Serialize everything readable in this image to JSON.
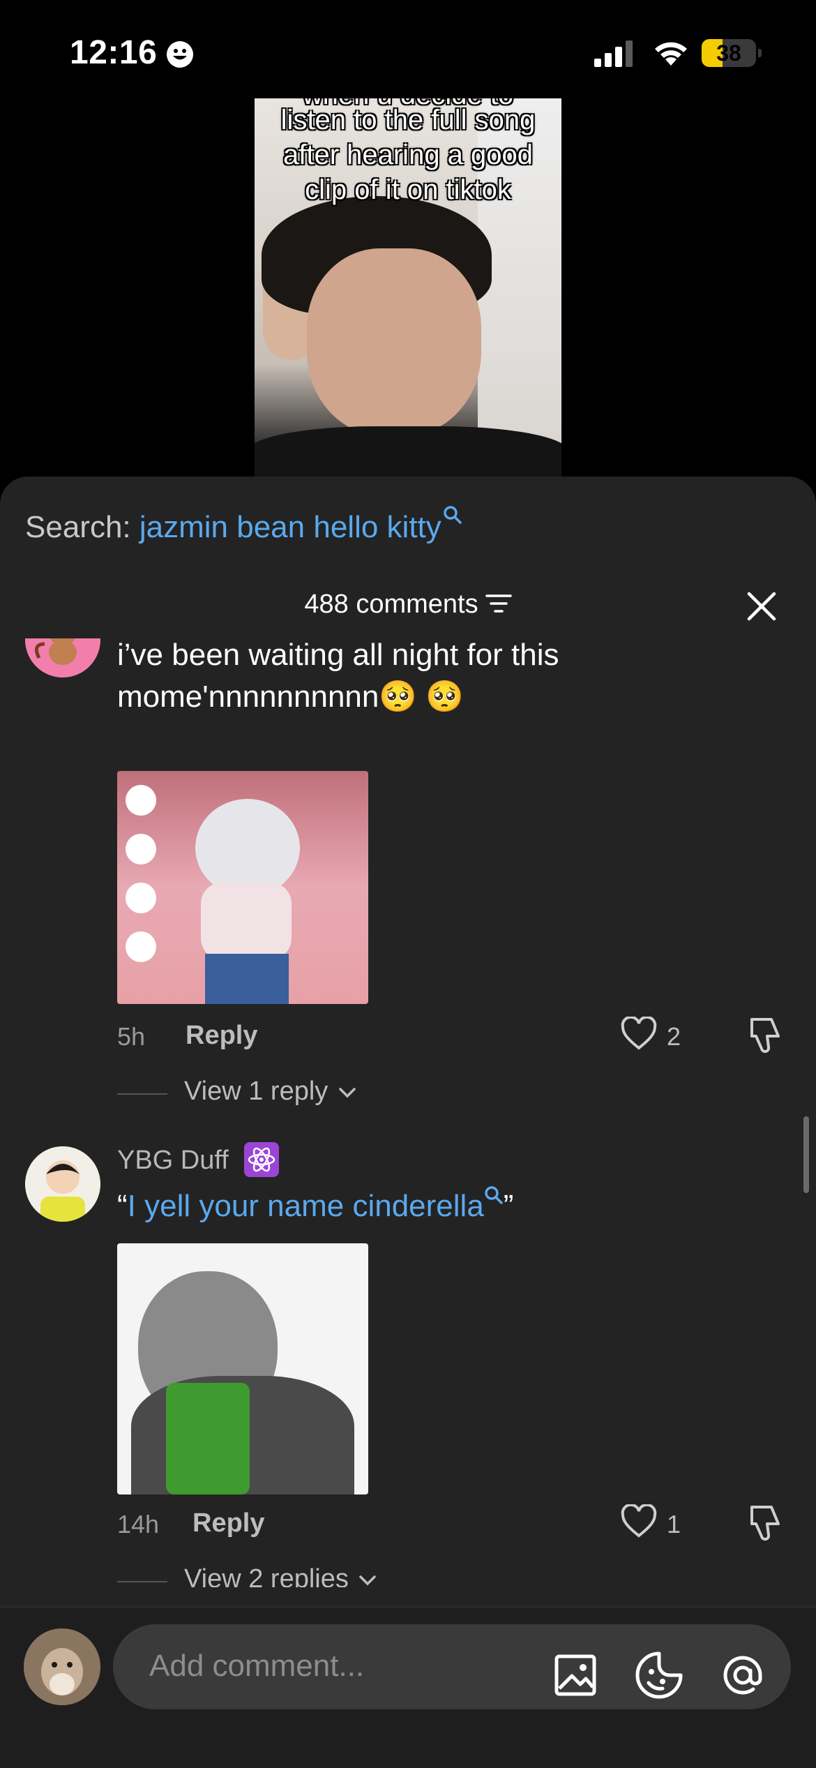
{
  "status_bar": {
    "time": "12:16",
    "battery": "38",
    "battery_level": 0.38
  },
  "video": {
    "caption_partial": "when u decide to",
    "caption_lines": [
      "listen to the full song",
      "after hearing a good",
      "clip of it on tiktok"
    ]
  },
  "search": {
    "label": "Search:",
    "query": "jazmin bean hello kitty"
  },
  "header": {
    "comments_count": "488 comments"
  },
  "comments": [
    {
      "text_line1": "i’ve been waiting all night for this",
      "text_line2": "mome'nnnnnnnnnn🥺 🥺",
      "time": "5h",
      "reply_label": "Reply",
      "likes": "2",
      "view_replies": "View 1 reply"
    },
    {
      "username": "YBG Duff",
      "badge_icon": "atom-icon",
      "quote_open": "“",
      "quote_text": "I yell your name cinderella",
      "quote_close": "”",
      "time": "14h",
      "reply_label": "Reply",
      "likes": "1",
      "view_replies": "View 2 replies"
    }
  ],
  "composer": {
    "placeholder": "Add comment..."
  },
  "colors": {
    "accent_link": "#5aa9ee",
    "sheet_bg": "#232323",
    "battery_fill": "#f5cc00",
    "badge_purple": "#9b45d6"
  }
}
